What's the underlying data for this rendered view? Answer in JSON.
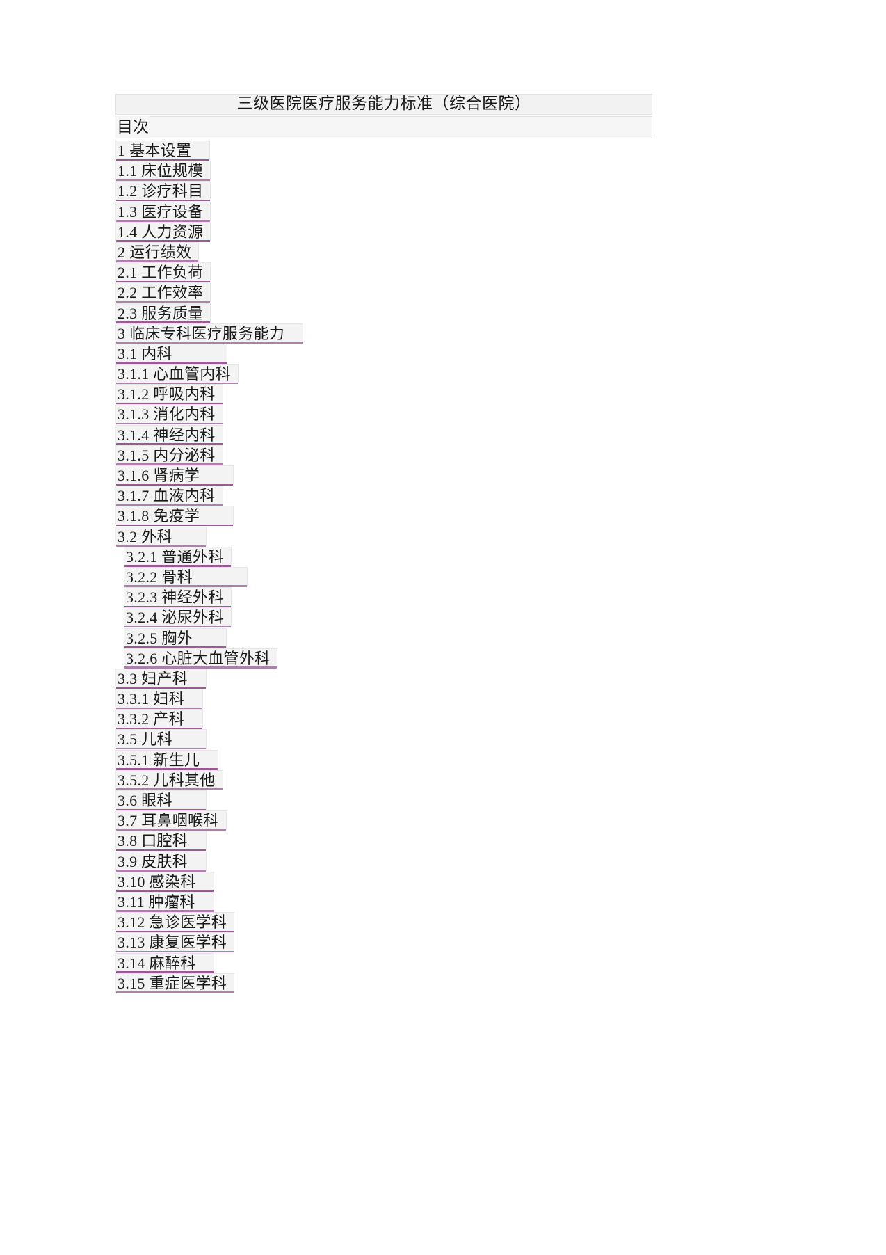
{
  "document": {
    "title": "三级医院医疗服务能力标准（综合医院）",
    "toc_heading": "目次"
  },
  "toc": {
    "entries": [
      {
        "label": "1 基本设置",
        "indent": 0,
        "pad": "md"
      },
      {
        "label": "1.1 床位规模",
        "indent": 0,
        "pad": "sm"
      },
      {
        "label": "1.2 诊疗科目",
        "indent": 0,
        "pad": "sm"
      },
      {
        "label": "1.3 医疗设备",
        "indent": 0,
        "pad": "sm"
      },
      {
        "label": "1.4 人力资源",
        "indent": 0,
        "pad": "sm"
      },
      {
        "label": "2   运行绩效",
        "indent": 0,
        "pad": "sm"
      },
      {
        "label": "2.1 工作负荷",
        "indent": 0,
        "pad": "sm"
      },
      {
        "label": "2.2 工作效率",
        "indent": 0,
        "pad": "sm"
      },
      {
        "label": "2.3 服务质量",
        "indent": 0,
        "pad": "sm"
      },
      {
        "label": "3   临床专科医疗服务能力",
        "indent": 0,
        "pad": "md"
      },
      {
        "label": "3.1 内科",
        "indent": 0,
        "pad": "xl"
      },
      {
        "label": "3.1.1  心血管内科",
        "indent": 0,
        "pad": "sm"
      },
      {
        "label": "3.1.2  呼吸内科",
        "indent": 0,
        "pad": "sm"
      },
      {
        "label": "3.1.3  消化内科",
        "indent": 0,
        "pad": "sm"
      },
      {
        "label": "3.1.4  神经内科",
        "indent": 0,
        "pad": "sm"
      },
      {
        "label": "3.1.5  内分泌科",
        "indent": 0,
        "pad": "sm"
      },
      {
        "label": "3.1.6  肾病学",
        "indent": 0,
        "pad": "lg"
      },
      {
        "label": "3.1.7  血液内科",
        "indent": 0,
        "pad": "sm"
      },
      {
        "label": "3.1.8  免疫学",
        "indent": 0,
        "pad": "lg"
      },
      {
        "label": "3.2 外科",
        "indent": 0,
        "pad": "lg"
      },
      {
        "label": "3.2.1 普通外科",
        "indent": 1,
        "pad": "sm"
      },
      {
        "label": "3.2.2 骨科",
        "indent": 1,
        "pad": "xl"
      },
      {
        "label": "3.2.3 神经外科",
        "indent": 1,
        "pad": "sm"
      },
      {
        "label": "3.2.4 泌尿外科",
        "indent": 1,
        "pad": "sm"
      },
      {
        "label": "3.2.5 胸外",
        "indent": 1,
        "pad": "lg"
      },
      {
        "label": "3.2.6 心脏大血管外科",
        "indent": 1,
        "pad": "sm"
      },
      {
        "label": "3.3 妇产科",
        "indent": 0,
        "pad": "md"
      },
      {
        "label": "3.3.1  妇科",
        "indent": 0,
        "pad": "md"
      },
      {
        "label": "3.3.2  产科",
        "indent": 0,
        "pad": "md"
      },
      {
        "label": "3.5 儿科",
        "indent": 0,
        "pad": "lg"
      },
      {
        "label": "3.5.1  新生儿",
        "indent": 0,
        "pad": "md"
      },
      {
        "label": "3.5.2  儿科其他",
        "indent": 0,
        "pad": "sm"
      },
      {
        "label": "3.6 眼科",
        "indent": 0,
        "pad": "lg"
      },
      {
        "label": "3.7 耳鼻咽喉科",
        "indent": 0,
        "pad": "sm"
      },
      {
        "label": "3.8 口腔科",
        "indent": 0,
        "pad": "md"
      },
      {
        "label": "3.9 皮肤科",
        "indent": 0,
        "pad": "md"
      },
      {
        "label": "3.10 感染科",
        "indent": 0,
        "pad": "md"
      },
      {
        "label": "3.11 肿瘤科",
        "indent": 0,
        "pad": "md"
      },
      {
        "label": "3.12 急诊医学科",
        "indent": 0,
        "pad": "sm"
      },
      {
        "label": "3.13 康复医学科",
        "indent": 0,
        "pad": "sm"
      },
      {
        "label": "3.14 麻醉科",
        "indent": 0,
        "pad": "md"
      },
      {
        "label": "3.15 重症医学科",
        "indent": 0,
        "pad": "sm"
      }
    ]
  },
  "colors": {
    "link_underline_dark": "#8e4f86",
    "link_underline_light": "#b07fae",
    "field_shading": "#f3f3f3",
    "title_shading": "#f2f2f2",
    "text": "#1a1a1a",
    "page_background": "#ffffff"
  }
}
